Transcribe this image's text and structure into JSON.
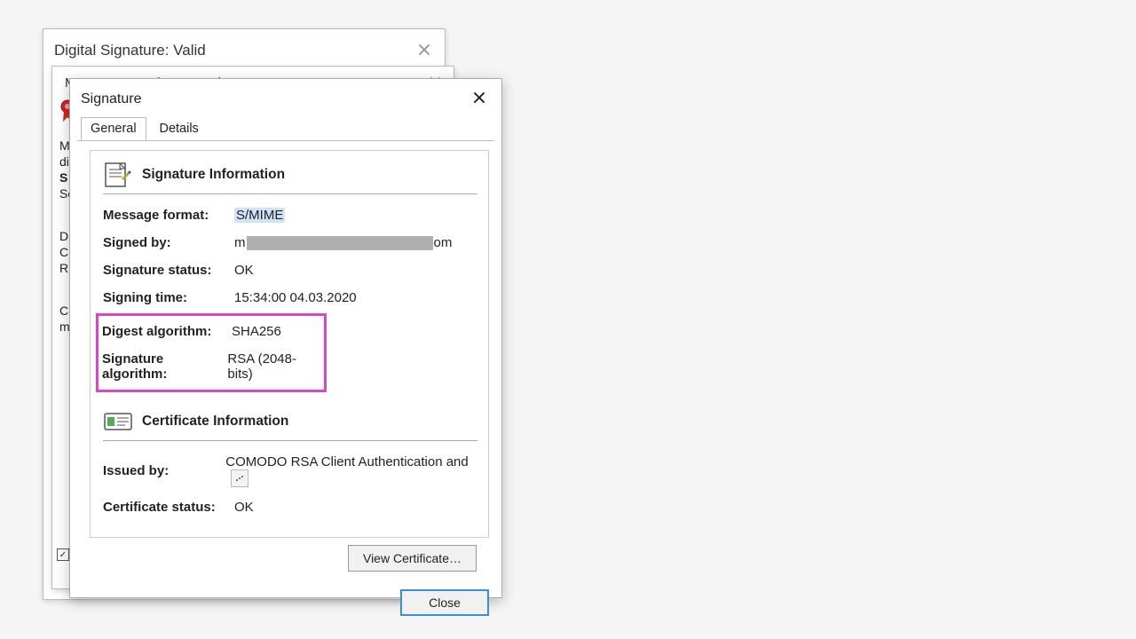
{
  "back_dialog": {
    "title": "Digital Signature: Valid"
  },
  "mid_dialog": {
    "title": "Message Security Properties",
    "side_lines": [
      "M",
      "di",
      "S",
      "Se",
      "",
      "D",
      "C",
      "R",
      "",
      "Cl",
      "m"
    ]
  },
  "front_dialog": {
    "title": "Signature",
    "tabs": {
      "general": "General",
      "details": "Details"
    },
    "signature_section": {
      "heading": "Signature Information",
      "rows": {
        "message_format": {
          "label": "Message format:",
          "value": "S/MIME"
        },
        "signed_by": {
          "label": "Signed by:",
          "value_prefix": "m",
          "value_suffix": "om"
        },
        "signature_status": {
          "label": "Signature status:",
          "value": "OK"
        },
        "signing_time": {
          "label": "Signing time:",
          "value": "15:34:00 04.03.2020"
        },
        "digest_algorithm": {
          "label": "Digest algorithm:",
          "value": "SHA256"
        },
        "signature_algorithm": {
          "label": "Signature algorithm:",
          "value": "RSA (2048-bits)"
        }
      }
    },
    "certificate_section": {
      "heading": "Certificate Information",
      "rows": {
        "issued_by": {
          "label": "Issued by:",
          "value": "COMODO RSA Client Authentication and"
        },
        "certificate_status": {
          "label": "Certificate status:",
          "value": "OK"
        }
      }
    },
    "buttons": {
      "view_certificate": "View Certificate…",
      "close": "Close"
    }
  }
}
